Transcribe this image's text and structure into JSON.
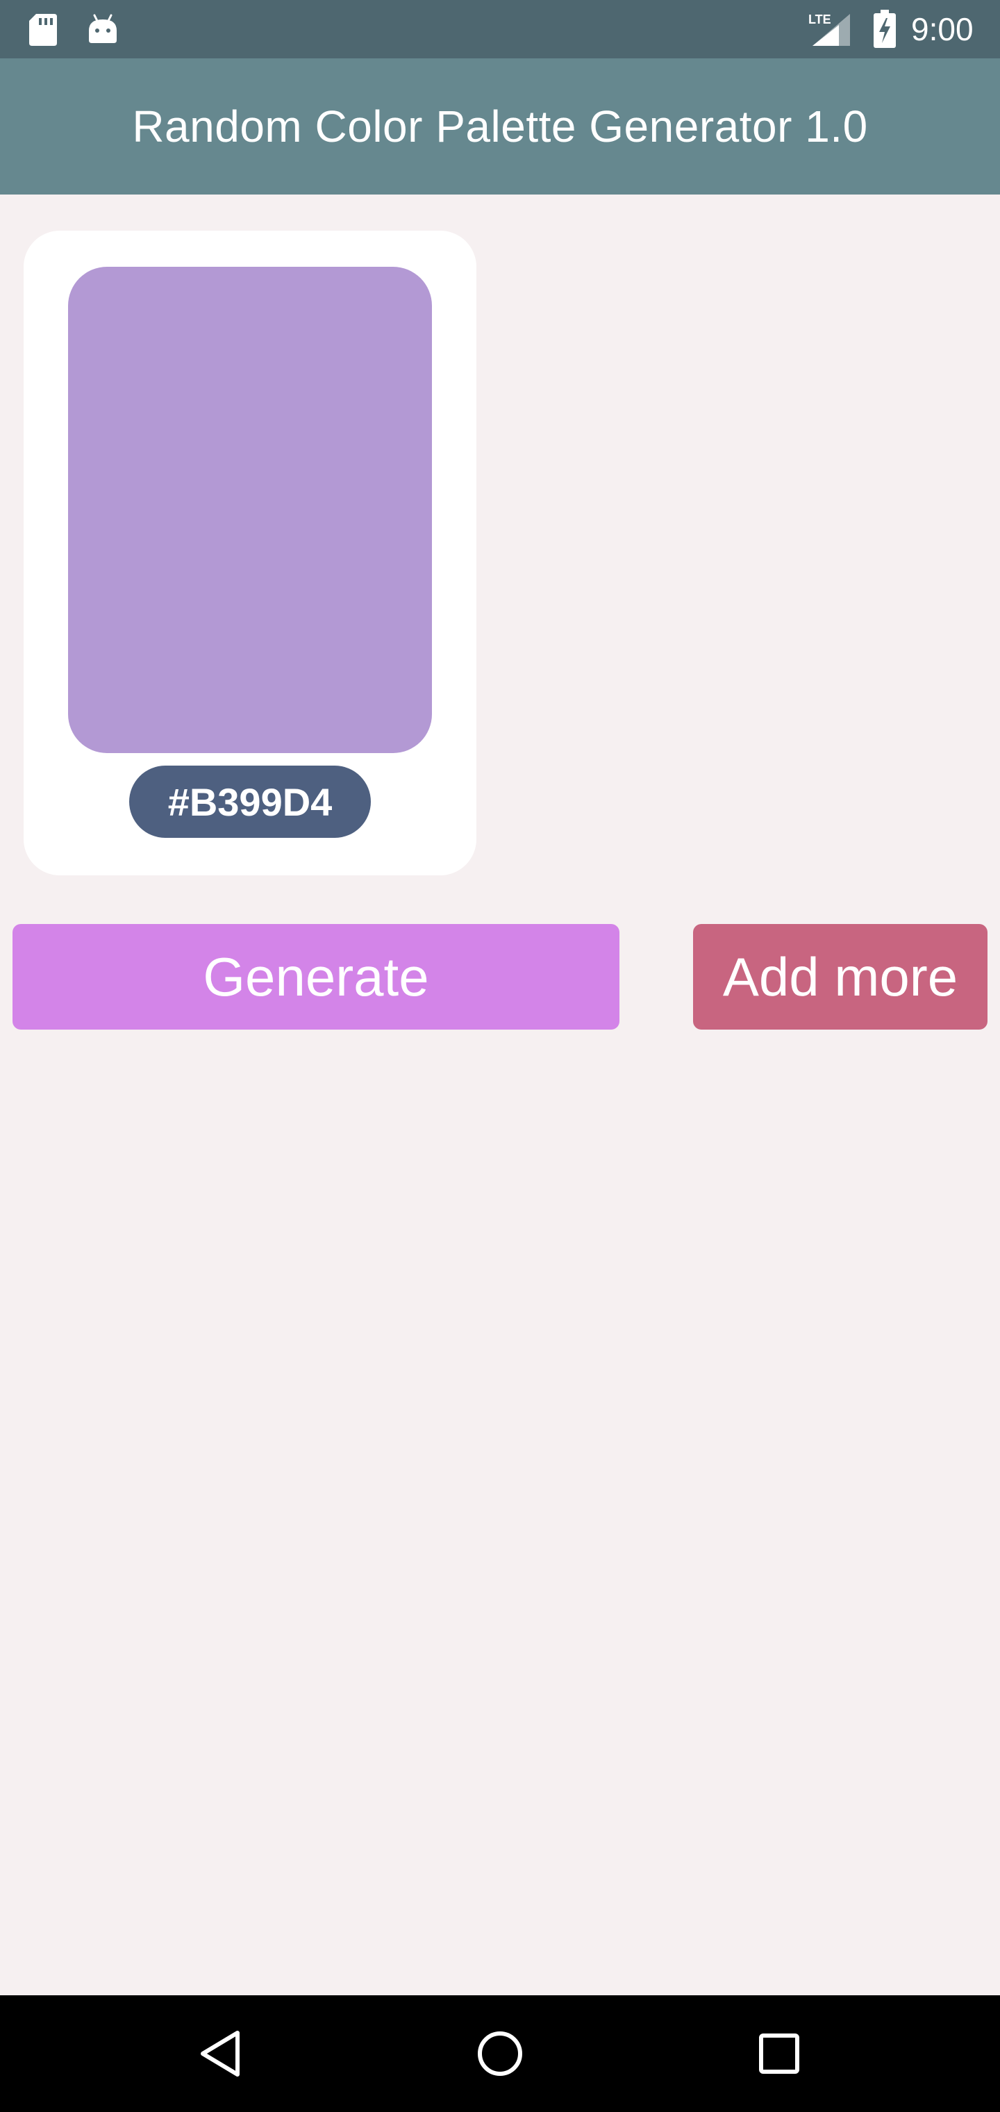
{
  "status_bar": {
    "time": "9:00",
    "network_label": "LTE",
    "icons": [
      "sd-card-icon",
      "android-icon",
      "lte-signal-icon",
      "battery-charging-icon"
    ]
  },
  "app_bar": {
    "title": "Random Color Palette Generator 1.0"
  },
  "palette": {
    "colors": [
      {
        "hex": "#B399D4"
      }
    ]
  },
  "actions": {
    "generate_label": "Generate",
    "add_more_label": "Add more"
  },
  "nav_bar": {
    "icons": [
      "back-icon",
      "home-icon",
      "recents-icon"
    ]
  },
  "theme": {
    "background": "#F6F0F1",
    "status_bar": "#4E6770",
    "app_bar": "#66888F",
    "hex_chip": "#4E6080",
    "generate_button": "#D384E8",
    "add_more_button": "#C86580",
    "nav_bar": "#000000"
  }
}
